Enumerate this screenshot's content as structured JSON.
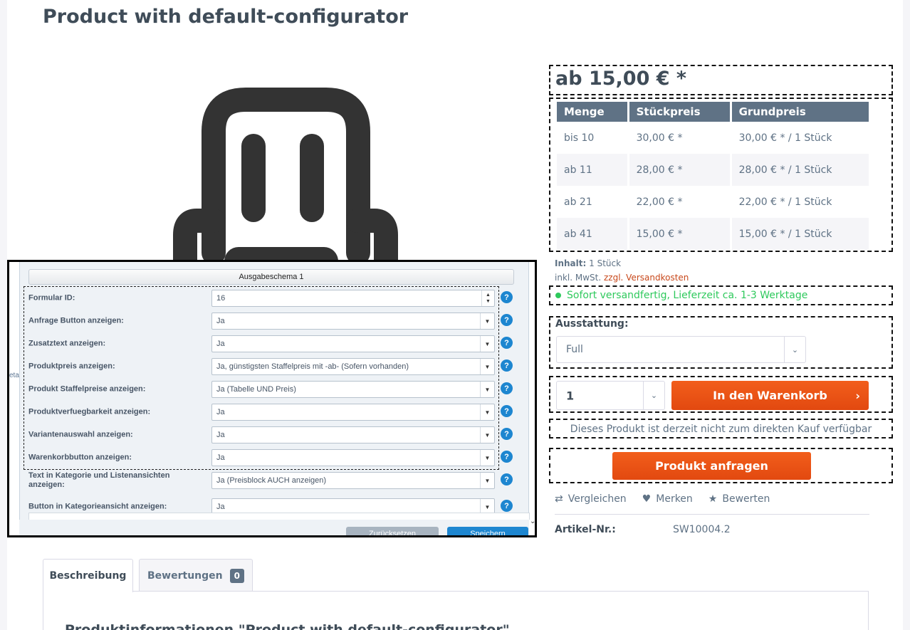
{
  "page": {
    "title": "Product with default-configurator"
  },
  "price": {
    "main": "ab 15,00 € *"
  },
  "tiers": {
    "headers": [
      "Menge",
      "Stückpreis",
      "Grundpreis"
    ],
    "rows": [
      [
        "bis 10",
        "30,00 € *",
        "30,00 € * / 1 Stück"
      ],
      [
        "ab 11",
        "28,00 € *",
        "28,00 € * / 1 Stück"
      ],
      [
        "ab 21",
        "22,00 € *",
        "22,00 € * / 1 Stück"
      ],
      [
        "ab 41",
        "15,00 € *",
        "15,00 € * / 1 Stück"
      ]
    ]
  },
  "info": {
    "inhalt_label": "Inhalt:",
    "inhalt_value": "1 Stück",
    "vat_text": "inkl. MwSt.",
    "shipping_link": "zzgl. Versandkosten",
    "availability": "Sofort versandfertig, Lieferzeit ca. 1-3 Werktage"
  },
  "config": {
    "label": "Ausstattung:",
    "selected": "Full"
  },
  "buy": {
    "quantity": "1",
    "cart_button": "In den Warenkorb",
    "not_buyable": "Dieses Produkt ist derzeit nicht zum direkten Kauf verfügbar",
    "request_button": "Produkt anfragen"
  },
  "actions": {
    "compare": "Vergleichen",
    "remember": "Merken",
    "rate": "Bewerten"
  },
  "article": {
    "label": "Artikel-Nr.:",
    "value": "SW10004.2"
  },
  "tabs": {
    "description": "Beschreibung",
    "reviews": "Bewertungen",
    "reviews_count": "0",
    "content_title": "Produktinformationen \"Product with default-configurator\""
  },
  "admin": {
    "header": "Ausgabeschema 1",
    "side_tab": "etai",
    "rows": [
      {
        "label": "Formular ID:",
        "value": "16",
        "kind": "spinner"
      },
      {
        "label": "Anfrage Button anzeigen:",
        "value": "Ja",
        "kind": "select"
      },
      {
        "label": "Zusatztext anzeigen:",
        "value": "Ja",
        "kind": "select"
      },
      {
        "label": "Produktpreis anzeigen:",
        "value": "Ja, günstigsten Staffelpreis mit -ab- (Sofern vorhanden)",
        "kind": "select"
      },
      {
        "label": "Produkt Staffelpreise anzeigen:",
        "value": "Ja (Tabelle UND Preis)",
        "kind": "select"
      },
      {
        "label": "Produktverfuegbarkeit anzeigen:",
        "value": "Ja",
        "kind": "select"
      },
      {
        "label": "Variantenauswahl anzeigen:",
        "value": "Ja",
        "kind": "select"
      },
      {
        "label": "Warenkorbbutton anzeigen:",
        "value": "Ja",
        "kind": "select"
      },
      {
        "label": "Text in Kategorie und Listenansichten anzeigen:",
        "value": "Ja (Preisblock AUCH anzeigen)",
        "kind": "select"
      },
      {
        "label": "Button in Kategorieansicht anzeigen:",
        "value": "Ja",
        "kind": "select"
      }
    ],
    "cancel_button": "Zurücksetzen",
    "save_button": "Speichern"
  },
  "colors": {
    "accent": "#e24910",
    "available": "#2ec95c",
    "table_header": "#5f7285",
    "help": "#1d86d0"
  }
}
